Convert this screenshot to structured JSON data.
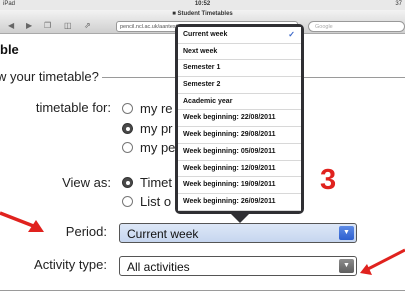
{
  "status_bar": {
    "carrier": "iPad",
    "time": "10:52",
    "battery": "37"
  },
  "browser": {
    "page_title": "Student Timetables",
    "url": "pencil.ncl.ac.uk/aantesti",
    "search_placeholder": "Google"
  },
  "page": {
    "heading": "ble",
    "fieldset_legend": "w your timetable?",
    "timetable_for": {
      "label": "timetable for:",
      "options": [
        "my re",
        "my pr",
        "my pe"
      ],
      "selected_index": 1
    },
    "view_as": {
      "label": "View as:",
      "options": [
        "Timet",
        "List o"
      ],
      "selected_index": 0
    },
    "period": {
      "label": "Period:",
      "value": "Current week"
    },
    "activity_type": {
      "label": "Activity type:",
      "value": "All activities"
    }
  },
  "dropdown": {
    "selected": "Current week",
    "options": [
      "Current week",
      "Next week",
      "Semester 1",
      "Semester 2",
      "Academic year",
      "Week beginning: 22/08/2011",
      "Week beginning: 29/08/2011",
      "Week beginning: 05/09/2011",
      "Week beginning: 12/09/2011",
      "Week beginning: 19/09/2011",
      "Week beginning: 26/09/2011"
    ]
  },
  "annotation": {
    "step_number": "3",
    "color": "#e0221e"
  },
  "icons": {
    "back": "back-arrow-icon",
    "forward": "forward-arrow-icon",
    "tabs": "tabs-icon",
    "bookmarks": "bookmarks-icon",
    "share": "share-icon",
    "lock": "lock-icon",
    "check": "checkmark-icon",
    "select_arrow": "chevron-down-icon"
  }
}
